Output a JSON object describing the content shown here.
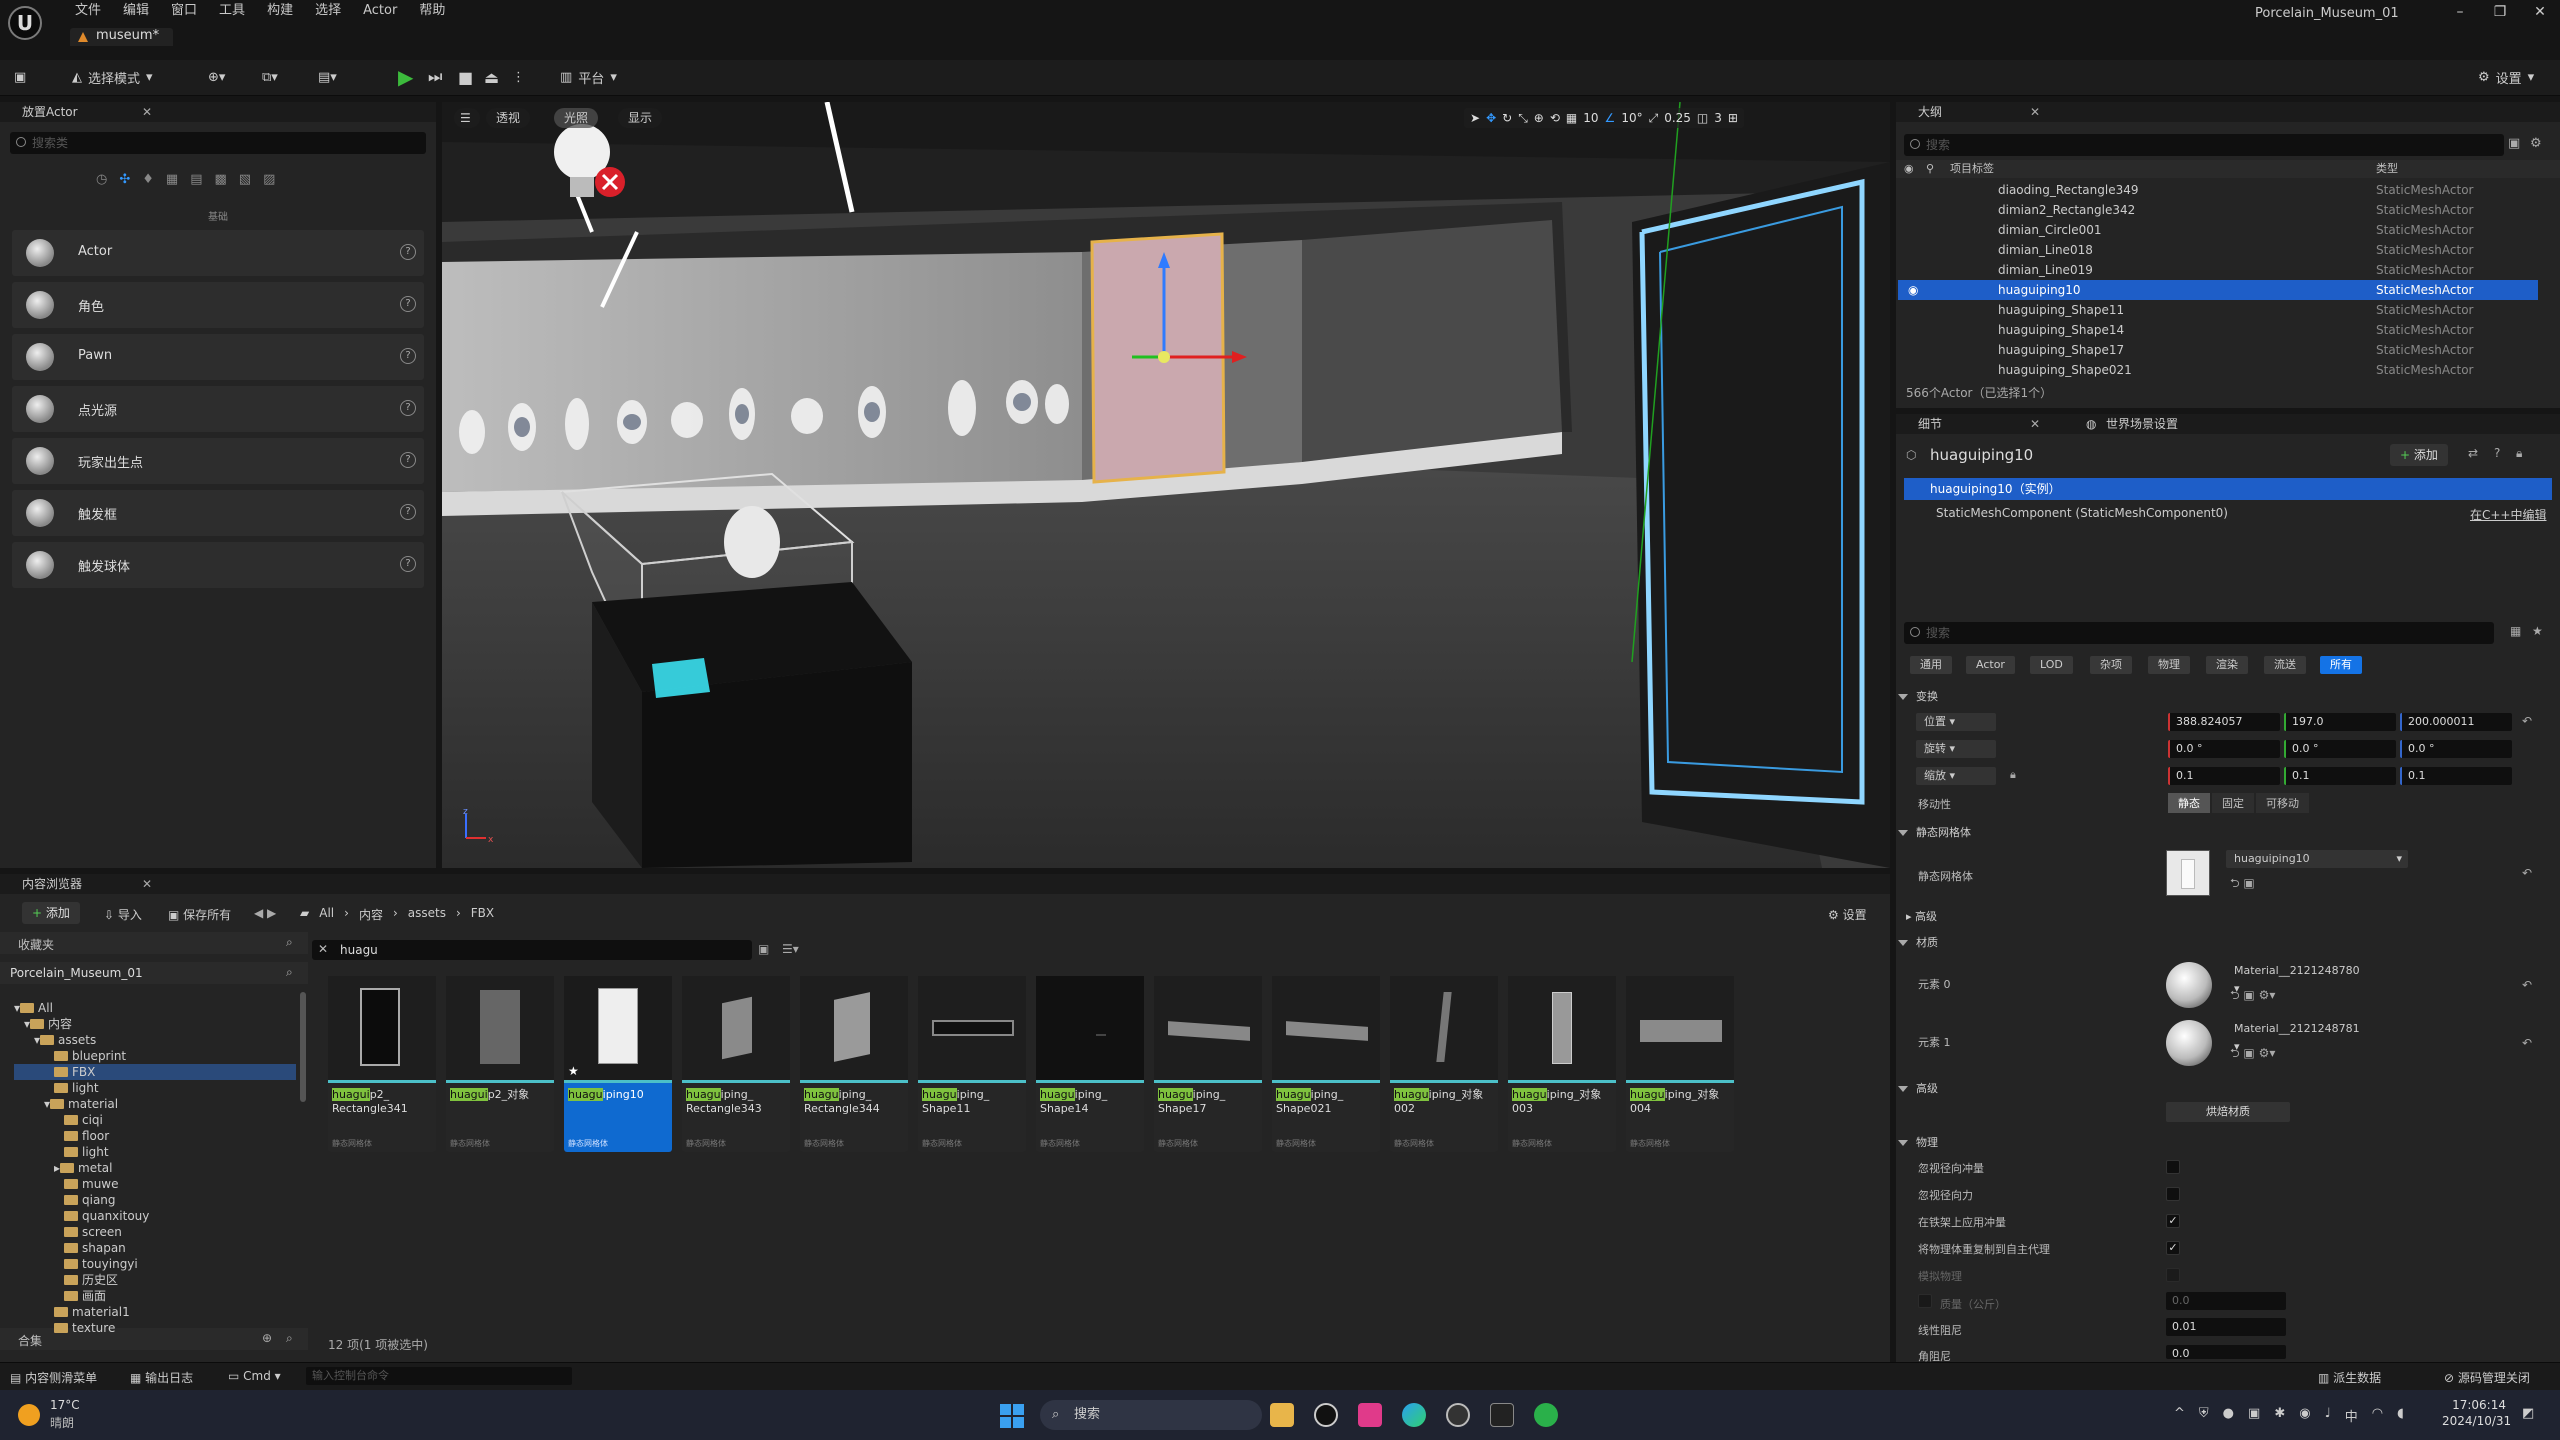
{
  "menubar": {
    "menus": [
      "文件",
      "编辑",
      "窗口",
      "工具",
      "构建",
      "选择",
      "Actor",
      "帮助"
    ],
    "level_tab": "museum*",
    "project_title": "Porcelain_Museum_01"
  },
  "toolbar": {
    "mode": "选择模式",
    "platform": "平台",
    "settings": "设置"
  },
  "place_actors": {
    "title": "放置Actor",
    "search_placeholder": "搜索类",
    "category_label": "基础",
    "items": [
      "Actor",
      "角色",
      "Pawn",
      "点光源",
      "玩家出生点",
      "触发框",
      "触发球体"
    ]
  },
  "viewport": {
    "perspective": "透视",
    "lit": "光照",
    "show": "显示",
    "grid_snap": "10",
    "rot_snap": "10°",
    "scale_snap": "0.25",
    "cam_speed": "3"
  },
  "outliner": {
    "title": "大纲",
    "search_placeholder": "搜索",
    "col_label": "项目标签",
    "col_type": "类型",
    "rows": [
      {
        "name": "diaoding_Rectangle349",
        "type": "StaticMeshActor"
      },
      {
        "name": "dimian2_Rectangle342",
        "type": "StaticMeshActor"
      },
      {
        "name": "dimian_Circle001",
        "type": "StaticMeshActor"
      },
      {
        "name": "dimian_Line018",
        "type": "StaticMeshActor"
      },
      {
        "name": "dimian_Line019",
        "type": "StaticMeshActor"
      },
      {
        "name": "huaguiping10",
        "type": "StaticMeshActor"
      },
      {
        "name": "huaguiping_Shape11",
        "type": "StaticMeshActor"
      },
      {
        "name": "huaguiping_Shape14",
        "type": "StaticMeshActor"
      },
      {
        "name": "huaguiping_Shape17",
        "type": "StaticMeshActor"
      },
      {
        "name": "huaguiping_Shape021",
        "type": "StaticMeshActor"
      }
    ],
    "footer": "566个Actor（已选择1个）"
  },
  "details": {
    "tab_details": "细节",
    "tab_world": "世界场景设置",
    "object_name": "huaguiping10",
    "add_label": "添加",
    "instance_label": "huaguiping10（实例）",
    "component": "StaticMeshComponent (StaticMeshComponent0)",
    "cpp_edit": "在C++中编辑",
    "search_placeholder": "搜索",
    "filter_tabs": [
      "通用",
      "Actor",
      "LOD",
      "杂项",
      "物理",
      "渲染",
      "流送",
      "所有"
    ],
    "transform": {
      "section": "变换",
      "location_label": "位置",
      "rotation_label": "旋转",
      "scale_label": "缩放",
      "location": [
        "388.824057",
        "197.0",
        "200.000011"
      ],
      "rotation": [
        "0.0 °",
        "0.0 °",
        "0.0 °"
      ],
      "scale": [
        "0.1",
        "0.1",
        "0.1"
      ],
      "mobility_label": "移动性",
      "mobility": [
        "静态",
        "固定",
        "可移动"
      ]
    },
    "static_mesh": {
      "section": "静态网格体",
      "label": "静态网格体",
      "value": "huaguiping10"
    },
    "advanced": "高级",
    "materials": {
      "section": "材质",
      "elements": [
        {
          "label": "元素 0",
          "value": "Material__2121248780"
        },
        {
          "label": "元素 1",
          "value": "Material__2121248781"
        }
      ]
    },
    "advanced2": "高级",
    "bake_button": "烘焙材质",
    "physics": {
      "section": "物理",
      "rows": [
        "忽视径向冲量",
        "忽视径向力",
        "在铁架上应用冲量",
        "将物理体重复制到自主代理",
        "模拟物理",
        "质量（公斤）",
        "线性阻尼",
        "角阻尼"
      ],
      "mass": "0.0",
      "linear_damping": "0.01",
      "angular_damping": "0.0"
    }
  },
  "content_browser": {
    "title": "内容浏览器",
    "add": "添加",
    "import": "导入",
    "save_all": "保存所有",
    "path": [
      "All",
      "内容",
      "assets",
      "FBX"
    ],
    "settings": "设置",
    "favorites": "收藏夹",
    "project": "Porcelain_Museum_01",
    "filter_text": "huagu",
    "collections": "合集",
    "status": "12 项(1 项被选中)",
    "tree": [
      "All",
      "内容",
      "assets",
      "blueprint",
      "FBX",
      "light",
      "material",
      "ciqi",
      "floor",
      "light",
      "metal",
      "muwe",
      "qiang",
      "quanxitouy",
      "screen",
      "shapan",
      "touyingyi",
      "历史区",
      "画面",
      "material1",
      "texture"
    ],
    "assets": [
      {
        "hl": "huagui",
        "rest": "p2_ Rectangle341",
        "type": "静态网格体"
      },
      {
        "hl": "huagui",
        "rest": "p2_对象",
        "type": "静态网格体"
      },
      {
        "hl": "huagu",
        "rest": "iping10",
        "type": "静态网格体"
      },
      {
        "hl": "huagu",
        "rest": "iping_ Rectangle343",
        "type": "静态网格体"
      },
      {
        "hl": "huagu",
        "rest": "iping_ Rectangle344",
        "type": "静态网格体"
      },
      {
        "hl": "huagu",
        "rest": "iping_ Shape11",
        "type": "静态网格体"
      },
      {
        "hl": "huagu",
        "rest": "iping_ Shape14",
        "type": "静态网格体"
      },
      {
        "hl": "huagu",
        "rest": "iping_ Shape17",
        "type": "静态网格体"
      },
      {
        "hl": "huagu",
        "rest": "iping_ Shape021",
        "type": "静态网格体"
      },
      {
        "hl": "huagu",
        "rest": "iping_对象 002",
        "type": "静态网格体"
      },
      {
        "hl": "huagu",
        "rest": "iping_对象 003",
        "type": "静态网格体"
      },
      {
        "hl": "huagu",
        "rest": "iping_对象 004",
        "type": "静态网格体"
      }
    ]
  },
  "statusbar": {
    "drawer": "内容侧滑菜单",
    "log": "输出日志",
    "cmd": "Cmd",
    "console_placeholder": "输入控制台命令",
    "derived": "派生数据",
    "source_control": "源码管理关闭"
  },
  "taskbar": {
    "weather_temp": "17°C",
    "weather_desc": "晴朗",
    "search": "搜索",
    "time": "17:06:14",
    "date": "2024/10/31"
  }
}
